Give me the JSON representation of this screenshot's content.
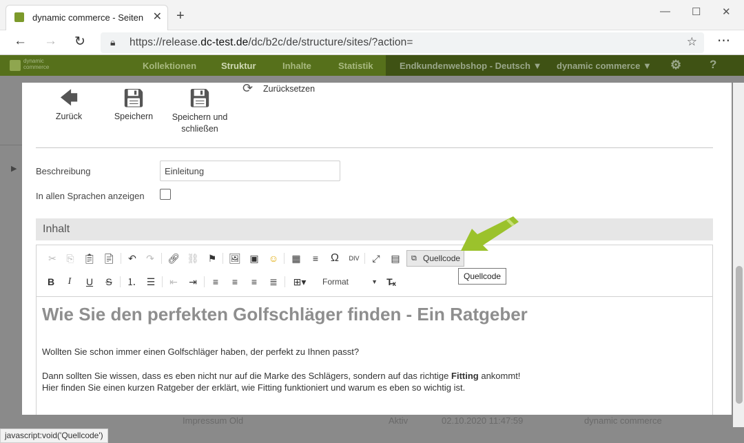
{
  "browser": {
    "tab_title": "dynamic commerce - Seiten",
    "url_prefix": "https://release.",
    "url_domain": "dc-test.de",
    "url_path": "/dc/b2c/de/structure/sites/?action=",
    "new_tab": "+",
    "tab_close": "✕",
    "window_controls": [
      "—",
      "☐",
      "✕"
    ]
  },
  "app": {
    "logo_text": "dynamic\ncommerce",
    "nav": [
      "Kollektionen",
      "Struktur",
      "Inhalte",
      "Statistik"
    ],
    "active_nav": "Struktur",
    "shop_selector": "Endkundenwebshop - Deutsch ▼",
    "user_menu": "dynamic commerce ▼",
    "settings_icon": "gear-icon",
    "help_label": "?"
  },
  "toolbar": {
    "back": "Zurück",
    "save": "Speichern",
    "save_close": "Speichern und schließen",
    "reset": "Zurücksetzen"
  },
  "form": {
    "description_label": "Beschreibung",
    "description_value": "Einleitung",
    "all_languages_label": "In allen Sprachen anzeigen",
    "all_languages_checked": false
  },
  "section": {
    "title": "Inhalt"
  },
  "editor": {
    "source_button": "Quellcode",
    "format_label": "Format",
    "tooltip": "Quellcode",
    "heading": "Wie Sie den perfekten Golfschläger finden - Ein Ratgeber",
    "p1": "Wollten Sie schon immer einen Golfschläger haben, der perfekt zu Ihnen passt?",
    "p2_pre": "Dann sollten Sie wissen, dass es eben nicht nur auf die Marke des Schlägers, sondern auf das richtige ",
    "p2_bold": "Fitting",
    "p2_post": " ankommt!",
    "p3": "Hier finden Sie einen kurzen Ratgeber der erklärt, wie Fitting funktioniert und warum es eben so wichtig ist."
  },
  "background_row": {
    "name": "Impressum Old",
    "status": "Aktiv",
    "date": "02.10.2020 11:47:59",
    "owner": "dynamic commerce"
  },
  "status_bar": "javascript:void('Quellcode')",
  "colors": {
    "app_green": "#56701b",
    "arrow_green": "#9bc22c",
    "heading_gray": "#8e8e8e"
  }
}
